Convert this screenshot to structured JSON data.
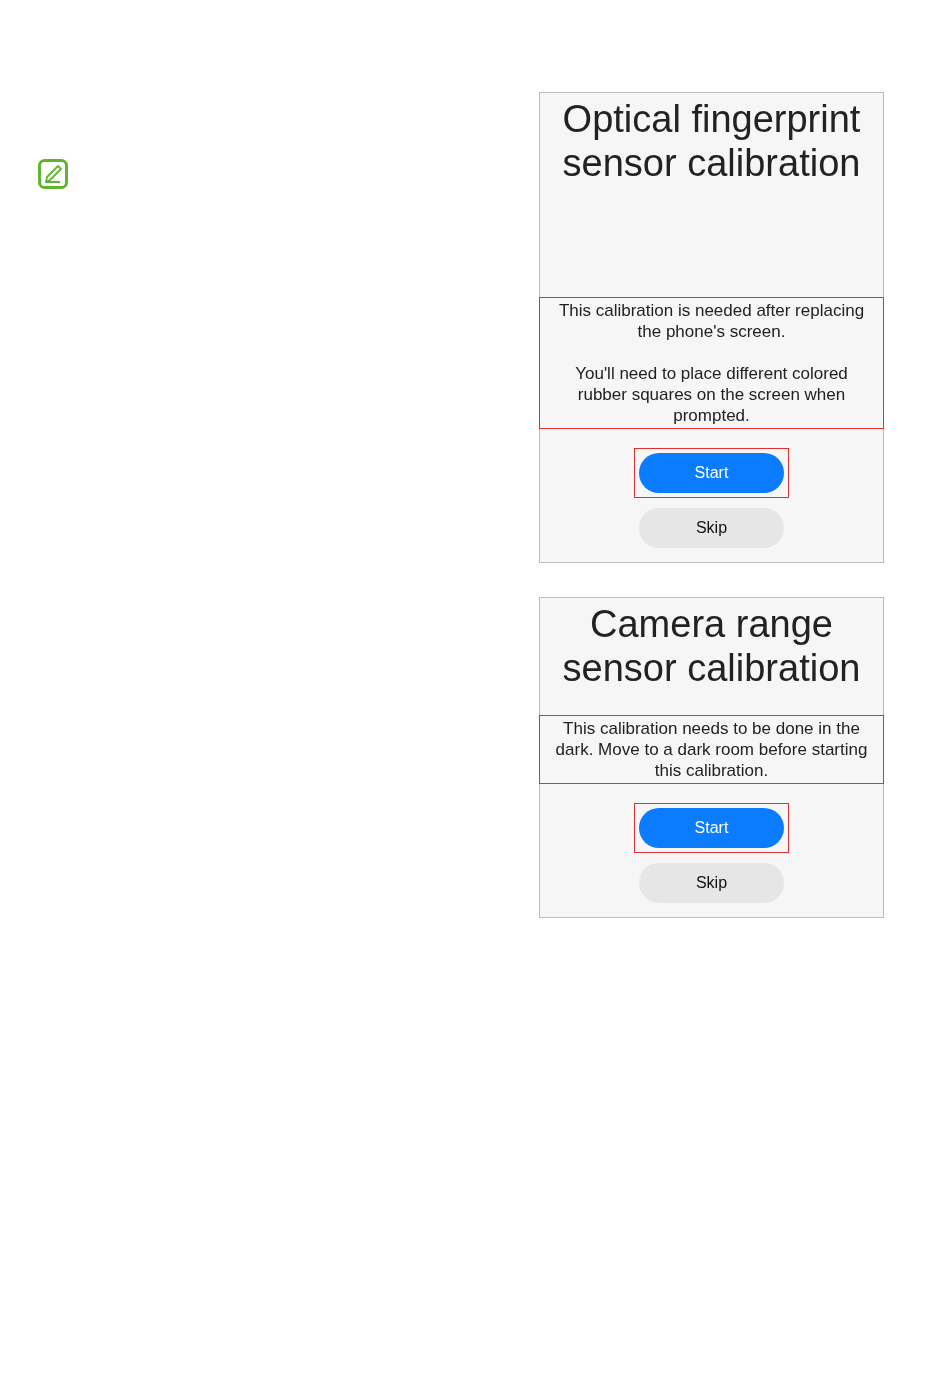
{
  "screens": [
    {
      "title": "Optical fingerprint sensor calibration",
      "body_highlighted": true,
      "paragraphs": [
        "This calibration is needed after replacing the phone's screen.",
        "You'll need to place different colored rubber squares on the screen when prompted."
      ],
      "buttons": [
        {
          "label": "Start",
          "kind": "primary",
          "highlighted": true
        },
        {
          "label": "Skip",
          "kind": "secondary",
          "highlighted": false
        }
      ]
    },
    {
      "title": "Camera range sensor calibration",
      "body_highlighted": true,
      "paragraphs": [
        "This calibration needs to be done in the dark. Move to a dark room before starting this calibration."
      ],
      "buttons": [
        {
          "label": "Start",
          "kind": "primary",
          "highlighted": true
        },
        {
          "label": "Skip",
          "kind": "secondary",
          "highlighted": false
        }
      ]
    }
  ]
}
